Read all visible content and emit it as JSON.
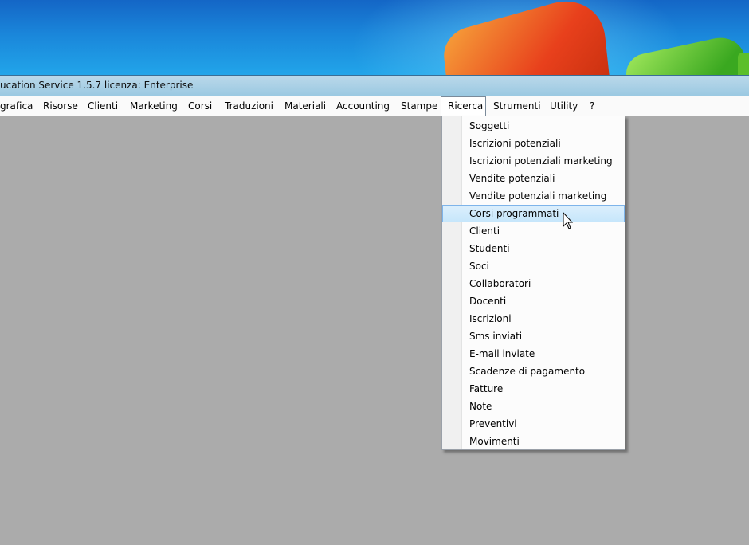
{
  "window": {
    "title": "ucation Service 1.5.7 licenza: Enterprise"
  },
  "menubar": {
    "items": [
      {
        "label": "grafica"
      },
      {
        "label": "Risorse"
      },
      {
        "label": "Clienti"
      },
      {
        "label": "Marketing"
      },
      {
        "label": "Corsi"
      },
      {
        "label": "Traduzioni"
      },
      {
        "label": "Materiali"
      },
      {
        "label": "Accounting"
      },
      {
        "label": "Stampe"
      },
      {
        "label": "Ricerca"
      },
      {
        "label": "Strumenti"
      },
      {
        "label": "Utility"
      },
      {
        "label": "?"
      }
    ],
    "active": "Ricerca"
  },
  "dropdown": {
    "items": [
      {
        "label": "Soggetti"
      },
      {
        "label": "Iscrizioni potenziali"
      },
      {
        "label": "Iscrizioni potenziali marketing"
      },
      {
        "label": "Vendite potenziali"
      },
      {
        "label": "Vendite potenziali marketing"
      },
      {
        "label": "Corsi programmati"
      },
      {
        "label": "Clienti"
      },
      {
        "label": "Studenti"
      },
      {
        "label": "Soci"
      },
      {
        "label": "Collaboratori"
      },
      {
        "label": "Docenti"
      },
      {
        "label": "Iscrizioni"
      },
      {
        "label": "Sms inviati"
      },
      {
        "label": "E-mail inviate"
      },
      {
        "label": "Scadenze di pagamento"
      },
      {
        "label": "Fatture"
      },
      {
        "label": "Note"
      },
      {
        "label": "Preventivi"
      },
      {
        "label": "Movimenti"
      }
    ],
    "highlighted": "Corsi programmati"
  },
  "colors": {
    "workspace": "#ababab",
    "highlight": "#c6e6fb",
    "highlight_border": "#7eb4ea"
  },
  "icons": {
    "cursor": "arrow-cursor-icon"
  }
}
